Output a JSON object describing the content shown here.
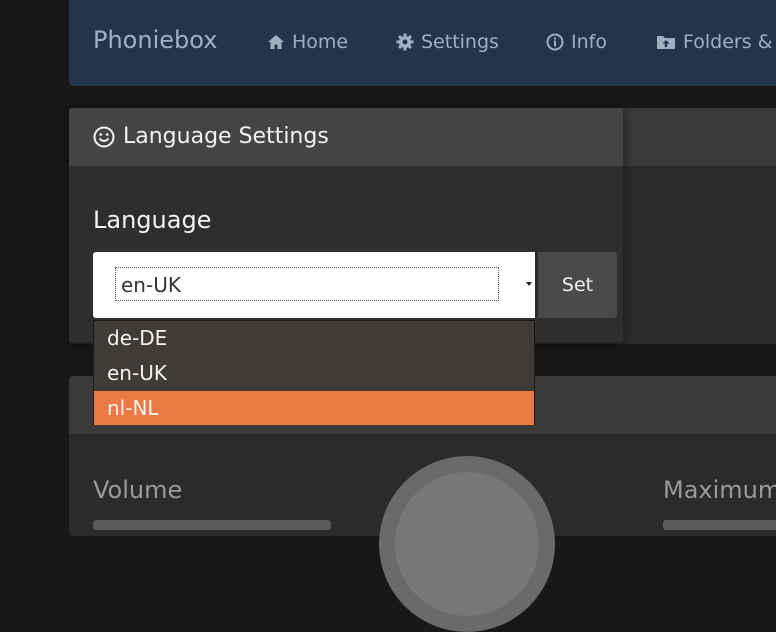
{
  "nav": {
    "brand": "Phoniebox",
    "items": [
      {
        "label": "Home",
        "icon": "home-icon"
      },
      {
        "label": "Settings",
        "icon": "gear-icon"
      },
      {
        "label": "Info",
        "icon": "info-icon"
      },
      {
        "label": "Folders &",
        "icon": "folder-upload-icon"
      }
    ]
  },
  "language_card": {
    "title": "Language Settings",
    "title_icon": "smiley-icon",
    "field_label": "Language",
    "selected_value": "en-UK",
    "set_label": "Set",
    "options": [
      "de-DE",
      "en-UK",
      "nl-NL"
    ],
    "highlighted_option": "nl-NL"
  },
  "volume_card": {
    "volume_label": "Volume",
    "maximum_label": "Maximum"
  },
  "colors": {
    "navbar": "#22354a",
    "highlight": "#ec7a45"
  }
}
